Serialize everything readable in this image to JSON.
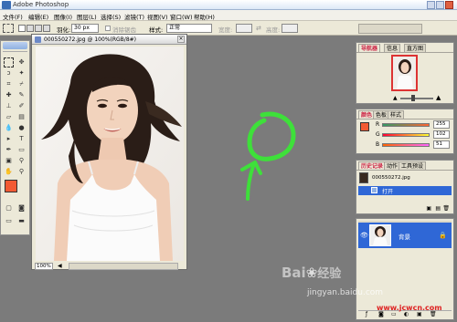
{
  "app": {
    "title": "Adobe Photoshop"
  },
  "menu": [
    "文件(F)",
    "编辑(E)",
    "图像(I)",
    "图层(L)",
    "选择(S)",
    "滤镜(T)",
    "视图(V)",
    "窗口(W)",
    "帮助(H)"
  ],
  "options": {
    "feather_label": "羽化:",
    "feather_value": "30 px",
    "antialias_label": "消除锯齿",
    "style_label": "样式:",
    "style_value": "正常",
    "width_label": "宽度:",
    "height_label": "高度:"
  },
  "document": {
    "title": "000550272.jpg @ 100%(RGB/8#)",
    "zoom": "100%"
  },
  "navigator": {
    "tabs": [
      "导航器",
      "信息",
      "直方图"
    ]
  },
  "color_panel": {
    "tabs": [
      "颜色",
      "色板",
      "样式"
    ],
    "r_label": "R",
    "r_value": "255",
    "g_label": "G",
    "g_value": "102",
    "b_label": "B",
    "b_value": "51",
    "fg_color": "#f25a33"
  },
  "history_panel": {
    "tabs": [
      "历史记录",
      "动作",
      "工具预设"
    ],
    "snapshot": "000550272.jpg",
    "items": [
      "打开"
    ]
  },
  "layers_panel": {
    "layer_name": "背景"
  },
  "annotation": {
    "color": "#3ee03a"
  },
  "watermark": {
    "brand": "Bai",
    "brand2": "经验",
    "url": "jingyan.baidu.com",
    "site": "www.jcwcn.com"
  }
}
